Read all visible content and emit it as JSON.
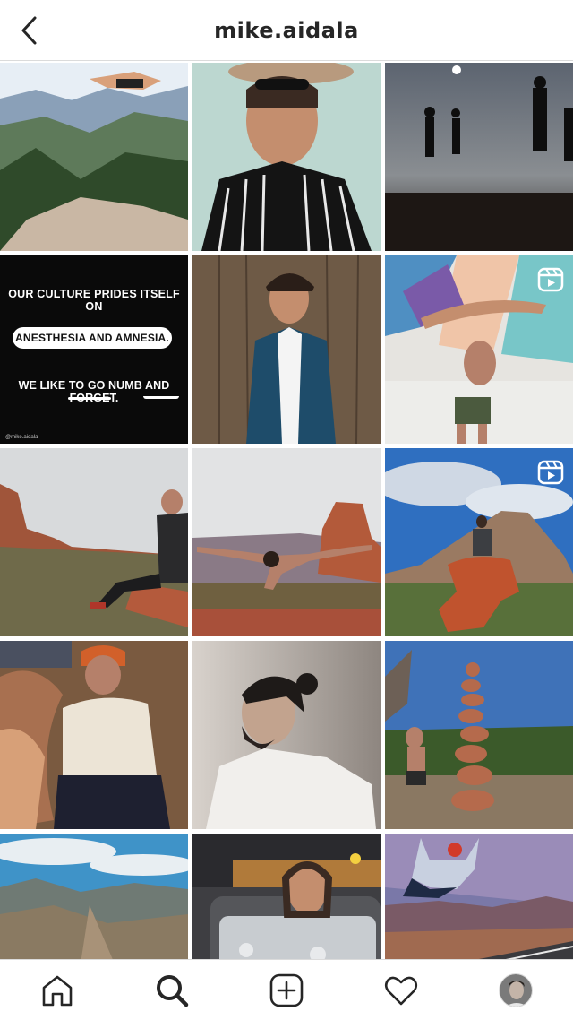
{
  "header": {
    "title": "mike.aidala",
    "back_icon": "chevron-left-icon"
  },
  "grid": {
    "posts": [
      {
        "id": "p1",
        "kind": "photo",
        "subject": "jumping-over-mountains"
      },
      {
        "id": "p2",
        "kind": "photo",
        "subject": "man-in-hat-striped-shirt"
      },
      {
        "id": "p3",
        "kind": "photo",
        "subject": "silhouettes-night-sky"
      },
      {
        "id": "p4",
        "kind": "text-graphic"
      },
      {
        "id": "p5",
        "kind": "photo",
        "subject": "man-in-blue-suit"
      },
      {
        "id": "p6",
        "kind": "reel",
        "subject": "acro-yoga-mural"
      },
      {
        "id": "p7",
        "kind": "photo",
        "subject": "man-sitting-red-rocks"
      },
      {
        "id": "p8",
        "kind": "photo",
        "subject": "yoga-pose-on-rock"
      },
      {
        "id": "p9",
        "kind": "reel",
        "subject": "man-on-rock-blue-sky"
      },
      {
        "id": "p10",
        "kind": "photo",
        "subject": "man-in-cave-beanie"
      },
      {
        "id": "p11",
        "kind": "photo",
        "subject": "man-bun-profile"
      },
      {
        "id": "p12",
        "kind": "photo",
        "subject": "rock-stack-cairn"
      },
      {
        "id": "p13",
        "kind": "photo",
        "subject": "mountain-canyon-view"
      },
      {
        "id": "p14",
        "kind": "photo",
        "subject": "man-in-ice-bath"
      },
      {
        "id": "p15",
        "kind": "photo",
        "subject": "jump-over-road"
      }
    ],
    "text_post": {
      "line1": "OUR CULTURE PRIDES ITSELF ON",
      "pill": "ANESTHESIA AND AMNESIA.",
      "line3": "WE LIKE TO GO NUMB AND FORGET.",
      "handle": "@mike.aidala"
    }
  },
  "tabbar": {
    "items": [
      {
        "name": "home",
        "icon": "home-icon"
      },
      {
        "name": "search",
        "icon": "search-icon",
        "active": true
      },
      {
        "name": "create",
        "icon": "add-post-icon"
      },
      {
        "name": "activity",
        "icon": "heart-icon"
      },
      {
        "name": "profile",
        "icon": "avatar"
      }
    ]
  },
  "colors": {
    "border": "#dbdbdb",
    "text": "#262626",
    "background": "#ffffff"
  }
}
